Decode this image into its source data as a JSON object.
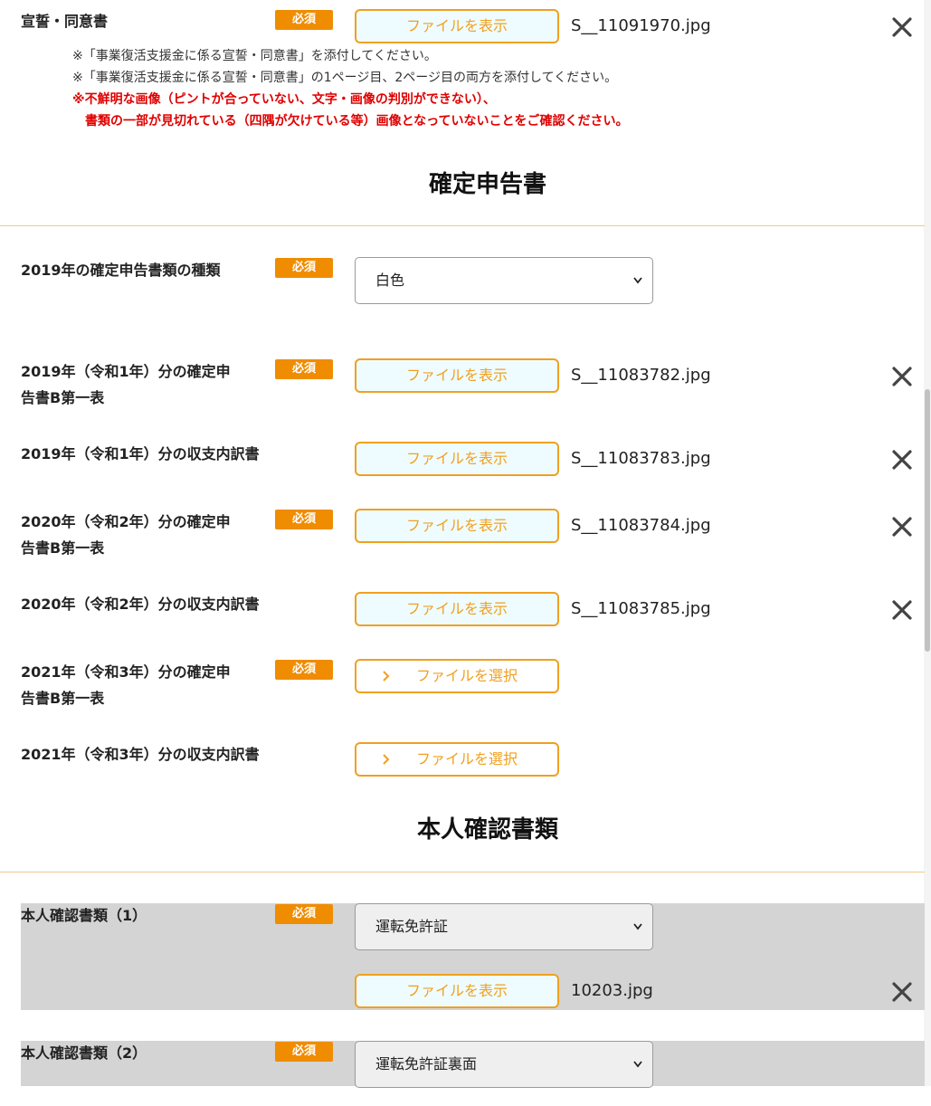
{
  "oath": {
    "label": "宣誓・同意書",
    "badge": "必須",
    "view_button": "ファイルを表示",
    "filename": "S__11091970.jpg",
    "notes": [
      "※「事業復活支援金に係る宣誓・同意書」を添付してください。",
      "※「事業復活支援金に係る宣誓・同意書」の1ページ目、2ページ目の両方を添付してください。"
    ],
    "warning_lines": [
      "※不鮮明な画像（ピントが合っていない、文字・画像の判別ができない）、",
      "　書類の一部が見切れている（四隅が欠けている等）画像となっていないことをご確認ください。"
    ]
  },
  "tax_section": {
    "title": "確定申告書",
    "type_field": {
      "label": "2019年の確定申告書類の種類",
      "badge": "必須",
      "selected": "白色"
    },
    "rows": [
      {
        "label_lines": [
          "2019年（令和1年）分の確定申",
          "告書B第一表"
        ],
        "badge": "必須",
        "button": "ファイルを表示",
        "filename": "S__11083782.jpg"
      },
      {
        "label_lines": [
          "2019年（令和1年）分の収支内訳書",
          ""
        ],
        "badge": "",
        "button": "ファイルを表示",
        "filename": "S__11083783.jpg"
      },
      {
        "label_lines": [
          "2020年（令和2年）分の確定申",
          "告書B第一表"
        ],
        "badge": "必須",
        "button": "ファイルを表示",
        "filename": "S__11083784.jpg"
      },
      {
        "label_lines": [
          "2020年（令和2年）分の収支内訳書",
          ""
        ],
        "badge": "",
        "button": "ファイルを表示",
        "filename": "S__11083785.jpg"
      },
      {
        "label_lines": [
          "2021年（令和3年）分の確定申",
          "告書B第一表"
        ],
        "badge": "必須",
        "button": "ファイルを選択",
        "filename": ""
      },
      {
        "label_lines": [
          "2021年（令和3年）分の収支内訳書",
          ""
        ],
        "badge": "",
        "button": "ファイルを選択",
        "filename": ""
      }
    ]
  },
  "id_section": {
    "title": "本人確認書類",
    "doc1": {
      "label": "本人確認書類（1）",
      "badge": "必須",
      "selected": "運転免許証",
      "button": "ファイルを表示",
      "filename": "10203.jpg"
    },
    "doc2": {
      "label": "本人確認書類（2）",
      "badge": "必須",
      "selected": "運転免許証裏面"
    }
  },
  "icons": {
    "close": "close-icon",
    "chevron_down": "chevron-down-icon",
    "chevron_right": "chevron-right-icon"
  },
  "colors": {
    "accent": "#f08c00",
    "button_border": "#f0a020",
    "button_bg": "#effcff",
    "warning": "#e00000",
    "divider": "#f3c98a",
    "gray_band": "#d4d4d4"
  }
}
